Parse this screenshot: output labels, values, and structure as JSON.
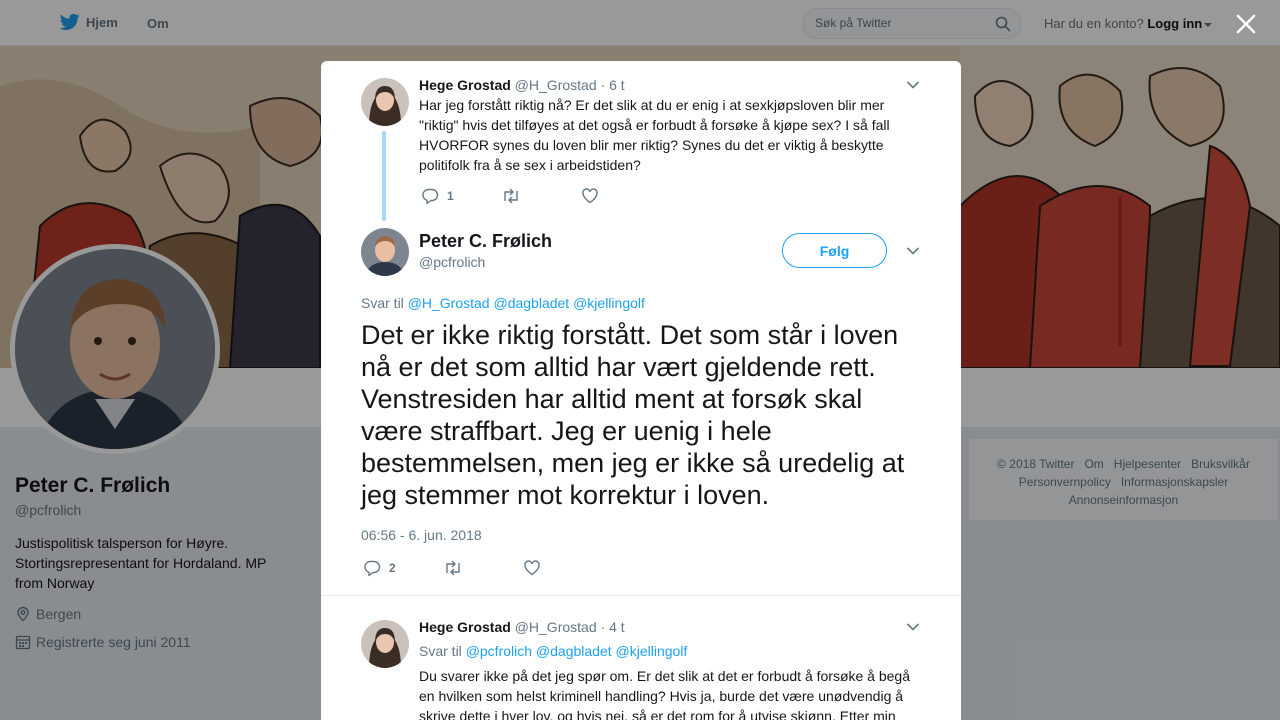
{
  "nav": {
    "home_label": "Hjem",
    "about_label": "Om",
    "search_placeholder": "Søk på Twitter",
    "account_prompt": "Har du en konto?",
    "login_label": "Logg inn"
  },
  "profile": {
    "name": "Peter C. Frølich",
    "handle": "@pcfrolich",
    "bio": "Justispolitisk talsperson for Høyre. Stortingsrepresentant for Hordaland. MP from Norway",
    "location": "Bergen",
    "joined": "Registrerte seg juni 2011"
  },
  "footer": {
    "links": [
      "© 2018 Twitter",
      "Om",
      "Hjelpesenter",
      "Bruksvilkår",
      "Personvernpolicy",
      "Informasjonskapsler",
      "Annonseinformasjon"
    ]
  },
  "modal": {
    "parent": {
      "name": "Hege Grostad",
      "handle": "@H_Grostad",
      "time": "· 6 t",
      "text": "Har jeg forstått riktig nå? Er det slik at du er enig i at sexkjøpsloven blir mer \"riktig\" hvis det tilføyes at det også er forbudt å forsøke å kjøpe sex? I så fall HVORFOR synes du loven blir mer riktig? Synes du det er viktig å beskytte politifolk fra å se sex i arbeidstiden?",
      "reply_count": "1"
    },
    "main": {
      "name": "Peter C. Frølich",
      "handle": "@pcfrolich",
      "follow_label": "Følg",
      "reply_prefix": "Svar til",
      "reply_mentions": "@H_Grostad @dagbladet @kjellingolf",
      "text": "Det er ikke riktig forstått. Det som står i loven nå er det som alltid har vært gjeldende rett. Venstresiden har alltid ment at forsøk skal være straffbart. Jeg er uenig i hele bestemmelsen, men jeg er ikke så uredelig at jeg stemmer mot korrektur i loven.",
      "timestamp": "06:56 - 6. jun. 2018",
      "reply_count": "2"
    },
    "reply": {
      "name": "Hege Grostad",
      "handle": "@H_Grostad",
      "time": "· 4 t",
      "reply_prefix": "Svar til",
      "reply_mentions": "@pcfrolich @dagbladet @kjellingolf",
      "text": "Du svarer ikke på det jeg spør om. Er det slik at det er forbudt å forsøke å begå en hvilken som helst kriminell handling? Hvis ja, burde det være unødvendig å skrive dette i hver lov, og hvis nei, så er det rom for å utvise skjønn. Etter min"
    }
  },
  "colors": {
    "accent": "#1da1f2",
    "thread_line": "#a4d9f9",
    "muted": "#657786"
  },
  "icons": [
    "twitter-bird-icon",
    "search-icon",
    "close-icon",
    "chevron-down-icon",
    "reply-icon",
    "retweet-icon",
    "like-icon",
    "location-icon",
    "calendar-icon"
  ]
}
